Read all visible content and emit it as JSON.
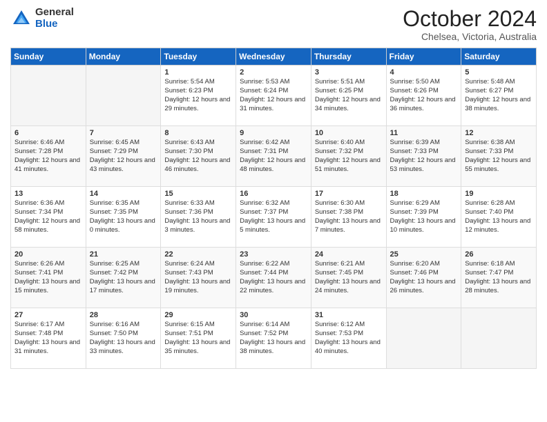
{
  "logo": {
    "general": "General",
    "blue": "Blue"
  },
  "header": {
    "month": "October 2024",
    "location": "Chelsea, Victoria, Australia"
  },
  "days_of_week": [
    "Sunday",
    "Monday",
    "Tuesday",
    "Wednesday",
    "Thursday",
    "Friday",
    "Saturday"
  ],
  "weeks": [
    [
      {
        "day": "",
        "sunrise": "",
        "sunset": "",
        "daylight": ""
      },
      {
        "day": "",
        "sunrise": "",
        "sunset": "",
        "daylight": ""
      },
      {
        "day": "1",
        "sunrise": "Sunrise: 5:54 AM",
        "sunset": "Sunset: 6:23 PM",
        "daylight": "Daylight: 12 hours and 29 minutes."
      },
      {
        "day": "2",
        "sunrise": "Sunrise: 5:53 AM",
        "sunset": "Sunset: 6:24 PM",
        "daylight": "Daylight: 12 hours and 31 minutes."
      },
      {
        "day": "3",
        "sunrise": "Sunrise: 5:51 AM",
        "sunset": "Sunset: 6:25 PM",
        "daylight": "Daylight: 12 hours and 34 minutes."
      },
      {
        "day": "4",
        "sunrise": "Sunrise: 5:50 AM",
        "sunset": "Sunset: 6:26 PM",
        "daylight": "Daylight: 12 hours and 36 minutes."
      },
      {
        "day": "5",
        "sunrise": "Sunrise: 5:48 AM",
        "sunset": "Sunset: 6:27 PM",
        "daylight": "Daylight: 12 hours and 38 minutes."
      }
    ],
    [
      {
        "day": "6",
        "sunrise": "Sunrise: 6:46 AM",
        "sunset": "Sunset: 7:28 PM",
        "daylight": "Daylight: 12 hours and 41 minutes."
      },
      {
        "day": "7",
        "sunrise": "Sunrise: 6:45 AM",
        "sunset": "Sunset: 7:29 PM",
        "daylight": "Daylight: 12 hours and 43 minutes."
      },
      {
        "day": "8",
        "sunrise": "Sunrise: 6:43 AM",
        "sunset": "Sunset: 7:30 PM",
        "daylight": "Daylight: 12 hours and 46 minutes."
      },
      {
        "day": "9",
        "sunrise": "Sunrise: 6:42 AM",
        "sunset": "Sunset: 7:31 PM",
        "daylight": "Daylight: 12 hours and 48 minutes."
      },
      {
        "day": "10",
        "sunrise": "Sunrise: 6:40 AM",
        "sunset": "Sunset: 7:32 PM",
        "daylight": "Daylight: 12 hours and 51 minutes."
      },
      {
        "day": "11",
        "sunrise": "Sunrise: 6:39 AM",
        "sunset": "Sunset: 7:33 PM",
        "daylight": "Daylight: 12 hours and 53 minutes."
      },
      {
        "day": "12",
        "sunrise": "Sunrise: 6:38 AM",
        "sunset": "Sunset: 7:33 PM",
        "daylight": "Daylight: 12 hours and 55 minutes."
      }
    ],
    [
      {
        "day": "13",
        "sunrise": "Sunrise: 6:36 AM",
        "sunset": "Sunset: 7:34 PM",
        "daylight": "Daylight: 12 hours and 58 minutes."
      },
      {
        "day": "14",
        "sunrise": "Sunrise: 6:35 AM",
        "sunset": "Sunset: 7:35 PM",
        "daylight": "Daylight: 13 hours and 0 minutes."
      },
      {
        "day": "15",
        "sunrise": "Sunrise: 6:33 AM",
        "sunset": "Sunset: 7:36 PM",
        "daylight": "Daylight: 13 hours and 3 minutes."
      },
      {
        "day": "16",
        "sunrise": "Sunrise: 6:32 AM",
        "sunset": "Sunset: 7:37 PM",
        "daylight": "Daylight: 13 hours and 5 minutes."
      },
      {
        "day": "17",
        "sunrise": "Sunrise: 6:30 AM",
        "sunset": "Sunset: 7:38 PM",
        "daylight": "Daylight: 13 hours and 7 minutes."
      },
      {
        "day": "18",
        "sunrise": "Sunrise: 6:29 AM",
        "sunset": "Sunset: 7:39 PM",
        "daylight": "Daylight: 13 hours and 10 minutes."
      },
      {
        "day": "19",
        "sunrise": "Sunrise: 6:28 AM",
        "sunset": "Sunset: 7:40 PM",
        "daylight": "Daylight: 13 hours and 12 minutes."
      }
    ],
    [
      {
        "day": "20",
        "sunrise": "Sunrise: 6:26 AM",
        "sunset": "Sunset: 7:41 PM",
        "daylight": "Daylight: 13 hours and 15 minutes."
      },
      {
        "day": "21",
        "sunrise": "Sunrise: 6:25 AM",
        "sunset": "Sunset: 7:42 PM",
        "daylight": "Daylight: 13 hours and 17 minutes."
      },
      {
        "day": "22",
        "sunrise": "Sunrise: 6:24 AM",
        "sunset": "Sunset: 7:43 PM",
        "daylight": "Daylight: 13 hours and 19 minutes."
      },
      {
        "day": "23",
        "sunrise": "Sunrise: 6:22 AM",
        "sunset": "Sunset: 7:44 PM",
        "daylight": "Daylight: 13 hours and 22 minutes."
      },
      {
        "day": "24",
        "sunrise": "Sunrise: 6:21 AM",
        "sunset": "Sunset: 7:45 PM",
        "daylight": "Daylight: 13 hours and 24 minutes."
      },
      {
        "day": "25",
        "sunrise": "Sunrise: 6:20 AM",
        "sunset": "Sunset: 7:46 PM",
        "daylight": "Daylight: 13 hours and 26 minutes."
      },
      {
        "day": "26",
        "sunrise": "Sunrise: 6:18 AM",
        "sunset": "Sunset: 7:47 PM",
        "daylight": "Daylight: 13 hours and 28 minutes."
      }
    ],
    [
      {
        "day": "27",
        "sunrise": "Sunrise: 6:17 AM",
        "sunset": "Sunset: 7:48 PM",
        "daylight": "Daylight: 13 hours and 31 minutes."
      },
      {
        "day": "28",
        "sunrise": "Sunrise: 6:16 AM",
        "sunset": "Sunset: 7:50 PM",
        "daylight": "Daylight: 13 hours and 33 minutes."
      },
      {
        "day": "29",
        "sunrise": "Sunrise: 6:15 AM",
        "sunset": "Sunset: 7:51 PM",
        "daylight": "Daylight: 13 hours and 35 minutes."
      },
      {
        "day": "30",
        "sunrise": "Sunrise: 6:14 AM",
        "sunset": "Sunset: 7:52 PM",
        "daylight": "Daylight: 13 hours and 38 minutes."
      },
      {
        "day": "31",
        "sunrise": "Sunrise: 6:12 AM",
        "sunset": "Sunset: 7:53 PM",
        "daylight": "Daylight: 13 hours and 40 minutes."
      },
      {
        "day": "",
        "sunrise": "",
        "sunset": "",
        "daylight": ""
      },
      {
        "day": "",
        "sunrise": "",
        "sunset": "",
        "daylight": ""
      }
    ]
  ]
}
